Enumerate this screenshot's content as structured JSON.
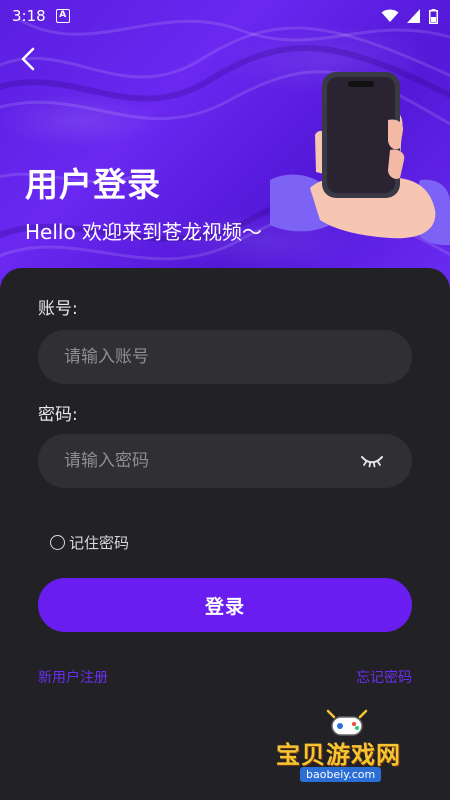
{
  "status_bar": {
    "time": "3:18",
    "notification_icon": "A",
    "icons": [
      "wifi-icon",
      "signal-icon",
      "battery-icon"
    ]
  },
  "header": {
    "back_icon": "chevron-left-icon",
    "title": "用户登录",
    "subtitle": "Hello 欢迎来到苍龙视频～"
  },
  "form": {
    "account": {
      "label": "账号:",
      "placeholder": "请输入账号",
      "value": ""
    },
    "password": {
      "label": "密码:",
      "placeholder": "请输入密码",
      "value": "",
      "toggle_icon": "eye-closed-icon"
    },
    "remember": {
      "label": "记住密码",
      "checked": false
    },
    "submit_label": "登录",
    "register_link": "新用户注册",
    "forgot_link": "忘记密码"
  },
  "watermark": {
    "text": "宝贝游戏网",
    "url": "baobeiy.com"
  },
  "colors": {
    "accent": "#6a1df0",
    "hero": "#5a1ee0",
    "card": "#222226",
    "input": "#2f2f34",
    "link": "#6a2ef0"
  }
}
